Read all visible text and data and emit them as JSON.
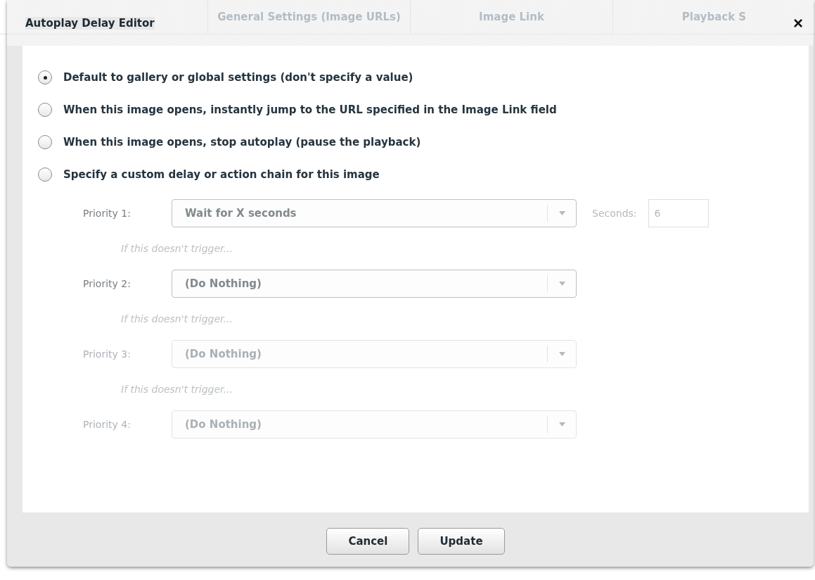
{
  "background_tabs": [
    {
      "label": "General Settings (Image URLs)"
    },
    {
      "label": "Image Link"
    },
    {
      "label": "Playback S"
    }
  ],
  "dialog": {
    "title": "Autoplay Delay Editor",
    "close": "×"
  },
  "options": [
    {
      "label": "Default to gallery or global settings (don't specify a value)",
      "selected": true
    },
    {
      "label": "When this image opens, instantly jump to the URL specified in the Image Link field",
      "selected": false
    },
    {
      "label": "When this image opens, stop autoplay (pause the playback)",
      "selected": false
    },
    {
      "label": "Specify a custom delay or action chain for this image",
      "selected": false
    }
  ],
  "priorities": [
    {
      "label": "Priority 1:",
      "value": "Wait for X seconds",
      "disabled": false,
      "seconds_label": "Seconds:",
      "seconds_value": "6",
      "note": "If this doesn't trigger..."
    },
    {
      "label": "Priority 2:",
      "value": "(Do Nothing)",
      "disabled": false,
      "note": "If this doesn't trigger..."
    },
    {
      "label": "Priority 3:",
      "value": "(Do Nothing)",
      "disabled": true,
      "note": "If this doesn't trigger..."
    },
    {
      "label": "Priority 4:",
      "value": "(Do Nothing)",
      "disabled": true
    }
  ],
  "buttons": [
    "Cancel",
    "Update"
  ]
}
